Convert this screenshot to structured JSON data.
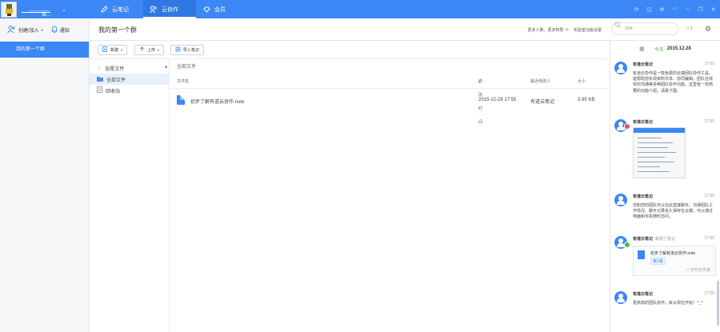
{
  "topbar": {
    "username": "________谁...",
    "tabs": [
      {
        "label": "云笔记",
        "icon": "pen-icon"
      },
      {
        "label": "云协作",
        "icon": "team-icon"
      },
      {
        "label": "会员",
        "icon": "diamond-icon"
      }
    ],
    "accent": "#3b87f5"
  },
  "sidebar": {
    "create_join": "创建/加入",
    "notify": "通知",
    "groups": [
      {
        "label": "我的第一个群"
      }
    ]
  },
  "header": {
    "group_title": "我的第一个群",
    "more_info": "更多人数，更多权限",
    "settings_link": "实验室功能设置",
    "search_placeholder": "搜索...",
    "member_count": "2"
  },
  "toolbar": {
    "new_label": "新建",
    "upload_label": "上传",
    "import_label": "导入笔记"
  },
  "tree": {
    "items": [
      {
        "label": "加星文件",
        "icon": "star-icon"
      },
      {
        "label": "全部文件",
        "icon": "folder-icon"
      },
      {
        "label": "回收站",
        "icon": "trash-icon"
      }
    ]
  },
  "files": {
    "breadcrumb": "全部文件",
    "columns": {
      "name": "文件名",
      "modified": "修改时间",
      "modifier": "最近修改人",
      "size": "大小"
    },
    "rows": [
      {
        "name": "初步了解有道云协作.note",
        "modified": "2015-12-28 17:55",
        "modifier": "有道云笔记",
        "size": "3.95 KB"
      }
    ]
  },
  "feed": {
    "today_label": "今天",
    "date": "2015.12.28",
    "messages": [
      {
        "sender": "有道云笔记",
        "time": "17:55",
        "body": "有道云协作是一款免费的云端团队协作工具，能帮助您实现资料共享、协同编辑。团队在线实时沟通等多种团队协作功能。这里有一份简要的功能介绍，请看下图。"
      },
      {
        "sender": "有道云笔记",
        "time": "17:55"
      },
      {
        "sender": "有道云笔记",
        "time": "17:55",
        "body": "您和您的团队可以在此直接聊天，沟通团队工作情况。聊天记录永久保存在云端，可以通过电脑和手机随时访问。"
      },
      {
        "sender": "有道云笔记",
        "sub": "新建了笔记",
        "time": "17:55",
        "file": "初步了解有道云协作.note",
        "version": "第1版",
        "open": "打开文件夹"
      },
      {
        "sender": "有道云笔记",
        "time": "17:55",
        "body": "更高效的团队协作，就从现在开始！^_^"
      }
    ]
  }
}
